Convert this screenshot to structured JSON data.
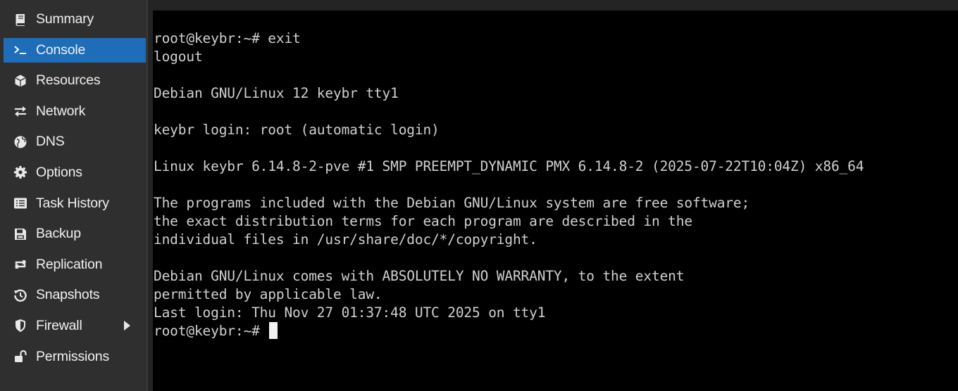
{
  "sidebar": {
    "items": [
      {
        "label": "Summary",
        "icon": "book-icon",
        "active": false
      },
      {
        "label": "Console",
        "icon": "terminal-prompt-icon",
        "active": true
      },
      {
        "label": "Resources",
        "icon": "cube-icon",
        "active": false
      },
      {
        "label": "Network",
        "icon": "exchange-arrows-icon",
        "active": false
      },
      {
        "label": "DNS",
        "icon": "globe-icon",
        "active": false
      },
      {
        "label": "Options",
        "icon": "gear-icon",
        "active": false
      },
      {
        "label": "Task History",
        "icon": "list-icon",
        "active": false
      },
      {
        "label": "Backup",
        "icon": "floppy-disk-icon",
        "active": false
      },
      {
        "label": "Replication",
        "icon": "retweet-icon",
        "active": false
      },
      {
        "label": "Snapshots",
        "icon": "history-icon",
        "active": false
      },
      {
        "label": "Firewall",
        "icon": "shield-icon",
        "active": false,
        "expandable": true
      },
      {
        "label": "Permissions",
        "icon": "unlock-icon",
        "active": false
      }
    ]
  },
  "terminal": {
    "lines": [
      "root@keybr:~# exit",
      "logout",
      "",
      "Debian GNU/Linux 12 keybr tty1",
      "",
      "keybr login: root (automatic login)",
      "",
      "Linux keybr 6.14.8-2-pve #1 SMP PREEMPT_DYNAMIC PMX 6.14.8-2 (2025-07-22T10:04Z) x86_64",
      "",
      "The programs included with the Debian GNU/Linux system are free software;",
      "the exact distribution terms for each program are described in the",
      "individual files in /usr/share/doc/*/copyright.",
      "",
      "Debian GNU/Linux comes with ABSOLUTELY NO WARRANTY, to the extent",
      "permitted by applicable law.",
      "Last login: Thu Nov 27 01:37:48 UTC 2025 on tty1"
    ],
    "prompt": "root@keybr:~# "
  },
  "colors": {
    "sidebar_bg": "#2f2f2f",
    "active_bg": "#1e6db8",
    "terminal_bg": "#000000",
    "terminal_fg": "#d0d0d0"
  }
}
